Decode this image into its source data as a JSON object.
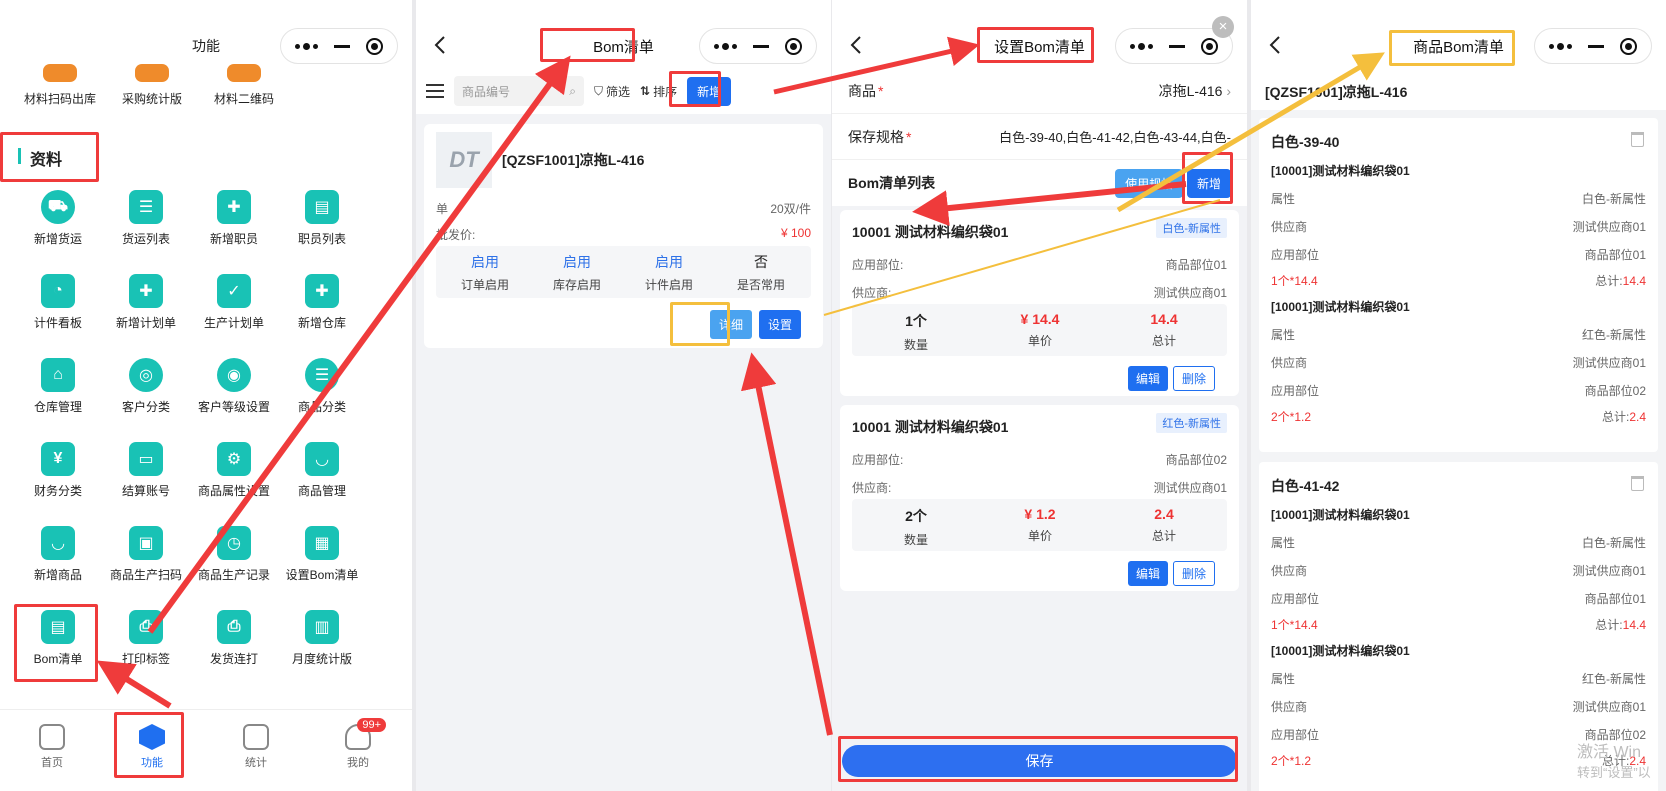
{
  "panel1": {
    "title": "功能",
    "top_items": [
      "材料扫码出库",
      "采购统计版",
      "材料二维码"
    ],
    "section": "资料",
    "grid": [
      [
        "新增货运",
        "货运列表",
        "新增职员",
        "职员列表"
      ],
      [
        "计件看板",
        "新增计划单",
        "生产计划单",
        "新增仓库"
      ],
      [
        "仓库管理",
        "客户分类",
        "客户等级设置",
        "商品分类"
      ],
      [
        "财务分类",
        "结算账号",
        "商品属性设置",
        "商品管理"
      ],
      [
        "新增商品",
        "商品生产扫码",
        "商品生产记录",
        "设置Bom清单"
      ],
      [
        "Bom清单",
        "打印标签",
        "发货连打",
        "月度统计版"
      ]
    ],
    "tabs": [
      "首页",
      "功能",
      "统计",
      "我的"
    ],
    "badge": "99+"
  },
  "panel2": {
    "title": "Bom清单",
    "search_placeholder": "商品编号",
    "filter_label": "筛选",
    "sort_label": "排序",
    "add_label": "新增",
    "product_name": "[QZSF1001]凉拖L-416",
    "unit_label": "单",
    "unit_value": "20双/件",
    "price_label": "批发价:",
    "price_value": "¥ 100",
    "states": [
      {
        "value": "启用",
        "label": "订单启用"
      },
      {
        "value": "启用",
        "label": "库存启用"
      },
      {
        "value": "启用",
        "label": "计件启用"
      },
      {
        "value": "否",
        "label": "是否常用"
      }
    ],
    "detail_btn": "详细",
    "setting_btn": "设置",
    "logo_text": "DT"
  },
  "panel3": {
    "title": "设置Bom清单",
    "product_label": "商品",
    "product_value": "凉拖L-416",
    "spec_label": "保存规格",
    "spec_value": "白色-39-40,白色-41-42,白色-43-44,白色-",
    "list_title": "Bom清单列表",
    "use_spec_btn": "使用规格",
    "add_btn": "新增",
    "items": [
      {
        "name": "10001 测试材料编织袋01",
        "tag": "白色-新属性",
        "part_label": "应用部位:",
        "part": "商品部位01",
        "supplier_label": "供应商:",
        "supplier": "测试供应商01",
        "qty": "1个",
        "qty_label": "数量",
        "price": "¥ 14.4",
        "price_label": "单价",
        "total": "14.4",
        "total_label": "总计"
      },
      {
        "name": "10001 测试材料编织袋01",
        "tag": "红色-新属性",
        "part_label": "应用部位:",
        "part": "商品部位02",
        "supplier_label": "供应商:",
        "supplier": "测试供应商01",
        "qty": "2个",
        "qty_label": "数量",
        "price": "¥ 1.2",
        "price_label": "单价",
        "total": "2.4",
        "total_label": "总计"
      }
    ],
    "edit_btn": "编辑",
    "delete_btn": "删除",
    "save_btn": "保存"
  },
  "panel4": {
    "title": "商品Bom清单",
    "product": "[QZSF1001]凉拖L-416",
    "groups": [
      {
        "spec": "白色-39-40",
        "items": [
          {
            "name": "[10001]测试材料编织袋01",
            "attr": "白色-新属性",
            "supplier": "测试供应商01",
            "part": "商品部位01",
            "qty": "1个*14.4",
            "total": "14.4"
          },
          {
            "name": "[10001]测试材料编织袋01",
            "attr": "红色-新属性",
            "supplier": "测试供应商01",
            "part": "商品部位02",
            "qty": "2个*1.2",
            "total": "2.4"
          }
        ]
      },
      {
        "spec": "白色-41-42",
        "items": [
          {
            "name": "[10001]测试材料编织袋01",
            "attr": "白色-新属性",
            "supplier": "测试供应商01",
            "part": "商品部位01",
            "qty": "1个*14.4",
            "total": "14.4"
          },
          {
            "name": "[10001]测试材料编织袋01",
            "attr": "红色-新属性",
            "supplier": "测试供应商01",
            "part": "商品部位02",
            "qty": "2个*1.2",
            "total": "2.4"
          }
        ]
      }
    ],
    "attr_label": "属性",
    "supplier_label": "供应商",
    "part_label": "应用部位",
    "total_prefix": "总计:",
    "watermark1": "激活 Win",
    "watermark2": "转到“设置”以"
  }
}
